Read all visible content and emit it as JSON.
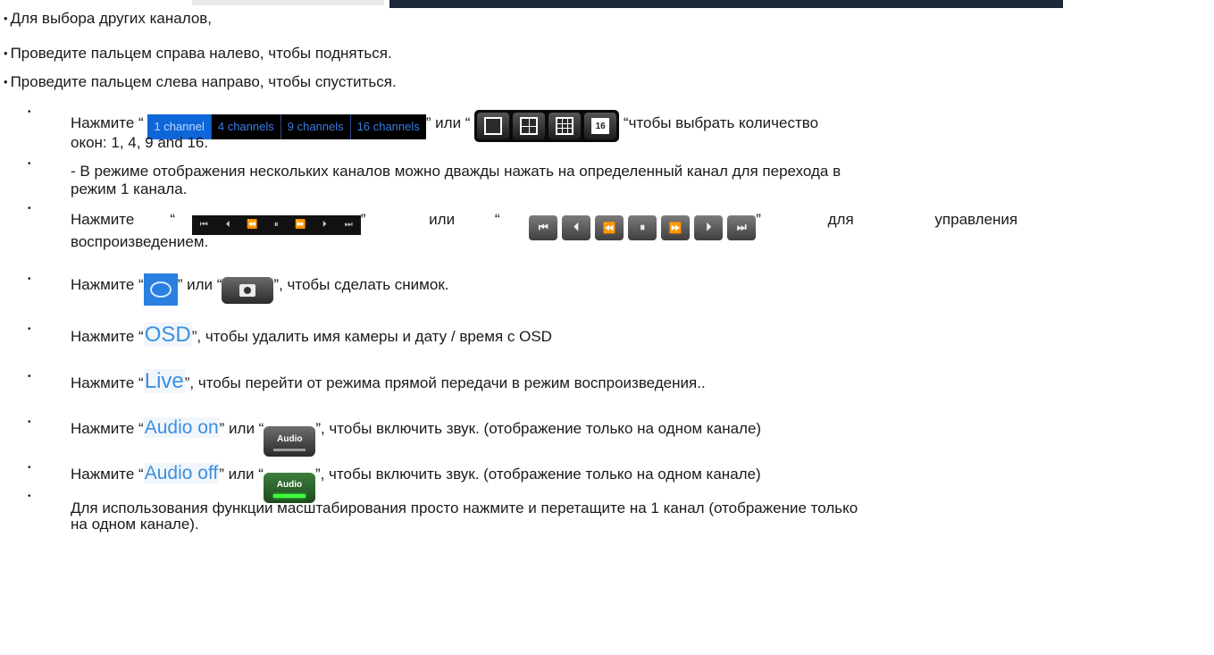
{
  "intro": [
    "Для выбора других каналов,",
    "Проведите пальцем справа налево, чтобы подняться.",
    "Проведите пальцем слева направо, чтобы спуститься."
  ],
  "bullet_top": "•",
  "bullet_item": "•",
  "channel_tabs": [
    "1 channel",
    "4 channels",
    "9 channels",
    "16 channels"
  ],
  "window_icons": [
    "single-window-icon",
    "quad-grid-icon",
    "nine-grid-icon",
    "sixteen-window-icon"
  ],
  "window_icon_16_label": "16",
  "playback_glyphs": [
    "⏮",
    "⏴",
    "⏪",
    "⏸",
    "⏩",
    "⏵",
    "⏭"
  ],
  "items": {
    "windows": {
      "pre": "Нажмите “",
      "mid": "” или “",
      "post": "“чтобы выбрать количество",
      "cont": "окон: 1, 4, 9 and 16."
    },
    "multi": {
      "line1": "- В режиме отображения нескольких каналов можно дважды нажать на определенный канал для перехода в",
      "line2": "режим 1 канала."
    },
    "playback": {
      "pre": "Нажмите",
      "q1": "“",
      "close1": "”",
      "or": "или",
      "q2": "“",
      "close2": "”",
      "for": "для",
      "control": "управления",
      "cont": "воспроизведением."
    },
    "snapshot": {
      "pre": "Нажмите “",
      "mid": "” или “",
      "post": "”, чтобы сделать снимок."
    },
    "osd": {
      "pre": "Нажмите “",
      "label": "OSD",
      "post": "”, чтобы удалить имя камеры и дату / время с OSD"
    },
    "live": {
      "pre": "Нажмите “",
      "label": "Live",
      "post": "”, чтобы перейти от режима прямой передачи в режим воспроизведения.."
    },
    "audio_on": {
      "pre": "Нажмите “",
      "label": "Audio on",
      "mid": "” или “",
      "btn": "Audio",
      "post": "”, чтобы включить звук. (отображение только на одном канале)"
    },
    "audio_off": {
      "pre": "Нажмите “",
      "label": "Audio off",
      "mid": "” или “",
      "btn": "Audio",
      "post": "”, чтобы включить звук. (отображение только на одном канале)"
    },
    "zoom": {
      "line1": "Для использования функции масштабирования просто нажмите и перетащите на 1 канал (отображение только",
      "line2": "на одном канале)."
    }
  }
}
